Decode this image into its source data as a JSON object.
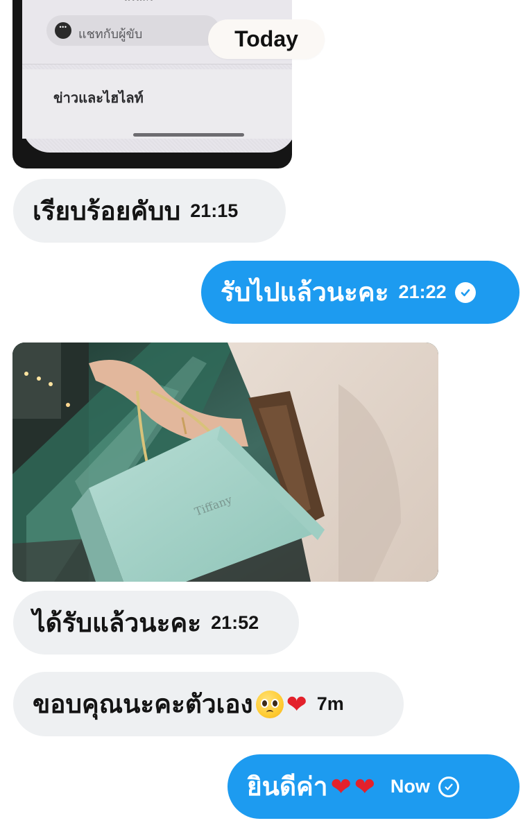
{
  "date_divider": "Today",
  "screenshot": {
    "top_text": "นรินทร์",
    "chat_label": "แชทกับผู้ขับ",
    "news_label": "ข่าวและไฮไลท์"
  },
  "messages": [
    {
      "dir": "in",
      "text": "เรียบร้อยคับบ",
      "time": "21:15"
    },
    {
      "dir": "out",
      "text": "รับไปแล้วนะคะ",
      "time": "21:22",
      "status": "delivered"
    },
    {
      "dir": "in",
      "text": "ได้รับแล้วนะคะ",
      "time": "21:52"
    },
    {
      "dir": "in",
      "text": "ขอบคุณนะคะตัวเอง",
      "time": "7m"
    },
    {
      "dir": "out",
      "text": "ยินดีค่า",
      "time": "Now",
      "status": "sent"
    }
  ],
  "colors": {
    "outgoing_bubble": "#1d9bf0",
    "incoming_bubble": "#eef0f2"
  }
}
